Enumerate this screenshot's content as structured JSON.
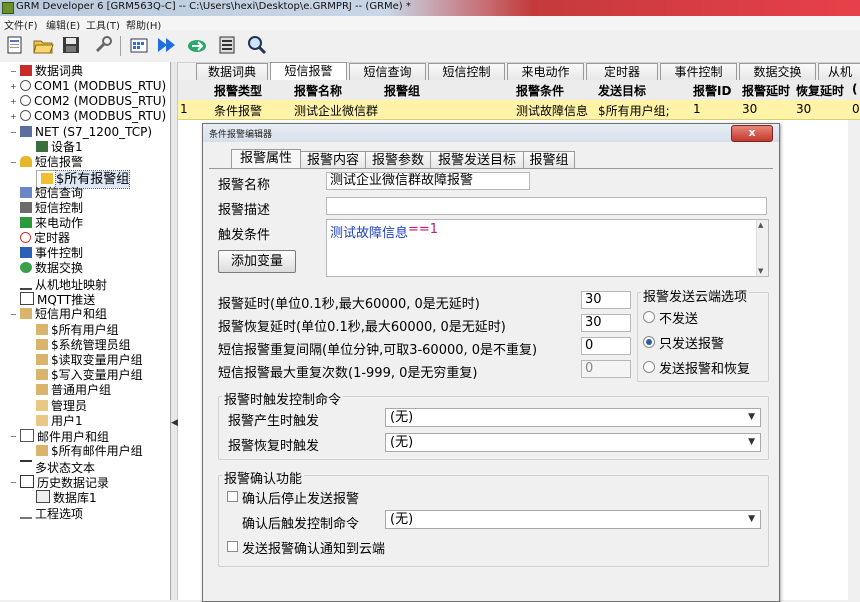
{
  "window": {
    "title": "GRM Developer 6 [GRM563Q-C]  -- C:\\Users\\hexi\\Desktop\\e.GRMPRJ -- (GRMe) *"
  },
  "menu": [
    "文件(F)",
    "编辑(E)",
    "工具(T)",
    "帮助(H)"
  ],
  "toolbar": {
    "icons": [
      "new-icon",
      "open-icon",
      "save-icon",
      "wrench-icon",
      "build-icon",
      "download-icon",
      "upload-icon",
      "device-icon",
      "search-icon"
    ]
  },
  "tree": [
    {
      "label": "数据词典",
      "icon": "book-icon",
      "exp": "−"
    },
    {
      "label": "COM1 (MODBUS_RTU)",
      "icon": "serial-icon",
      "exp": "+"
    },
    {
      "label": "COM2 (MODBUS_RTU)",
      "icon": "serial-icon",
      "exp": "+"
    },
    {
      "label": "COM3 (MODBUS_RTU)",
      "icon": "serial-icon",
      "exp": "+"
    },
    {
      "label": "NET (S7_1200_TCP)",
      "icon": "network-icon",
      "exp": "−"
    },
    {
      "label": "设备1",
      "icon": "device-icon",
      "exp": ""
    },
    {
      "label": "短信报警",
      "icon": "bell-icon",
      "exp": "−"
    },
    {
      "label": "$所有报警组",
      "icon": "alarm-group-icon",
      "exp": ""
    },
    {
      "label": "短信查询",
      "icon": "sms-query-icon",
      "exp": ""
    },
    {
      "label": "短信控制",
      "icon": "sms-control-icon",
      "exp": ""
    },
    {
      "label": "来电动作",
      "icon": "phone-icon",
      "exp": ""
    },
    {
      "label": "定时器",
      "icon": "timer-icon",
      "exp": ""
    },
    {
      "label": "事件控制",
      "icon": "event-icon",
      "exp": ""
    },
    {
      "label": "数据交换",
      "icon": "exchange-icon",
      "exp": ""
    },
    {
      "label": "从机地址映射",
      "icon": "map-icon",
      "exp": ""
    },
    {
      "label": "MQTT推送",
      "icon": "mqtt-icon",
      "exp": ""
    },
    {
      "label": "短信用户和组",
      "icon": "users-icon",
      "exp": "−"
    },
    {
      "label": "$所有用户组",
      "icon": "user-group-icon",
      "exp": ""
    },
    {
      "label": "$系统管理员组",
      "icon": "user-group-icon",
      "exp": ""
    },
    {
      "label": "$读取变量用户组",
      "icon": "user-group-icon",
      "exp": ""
    },
    {
      "label": "$写入变量用户组",
      "icon": "user-group-icon",
      "exp": ""
    },
    {
      "label": "普通用户组",
      "icon": "user-group-icon",
      "exp": ""
    },
    {
      "label": "管理员",
      "icon": "user-icon",
      "exp": ""
    },
    {
      "label": "用户1",
      "icon": "user-icon",
      "exp": ""
    },
    {
      "label": "邮件用户和组",
      "icon": "mail-icon",
      "exp": "−"
    },
    {
      "label": "$所有邮件用户组",
      "icon": "mail-group-icon",
      "exp": ""
    },
    {
      "label": "多状态文本",
      "icon": "text-icon",
      "exp": ""
    },
    {
      "label": "历史数据记录",
      "icon": "history-icon",
      "exp": "−"
    },
    {
      "label": "数据库1",
      "icon": "database-icon",
      "exp": ""
    },
    {
      "label": "工程选项",
      "icon": "wrench-icon",
      "exp": ""
    }
  ],
  "main_tabs": [
    "数据词典",
    "短信报警",
    "短信查询",
    "短信控制",
    "来电动作",
    "定时器",
    "事件控制",
    "数据交换",
    "从机"
  ],
  "grid": {
    "headers": [
      "报警类型",
      "报警名称",
      "报警组",
      "报警条件",
      "发送目标",
      "报警ID",
      "报警延时",
      "恢复延时",
      "("
    ],
    "row": [
      "1",
      "条件报警",
      "测试企业微信群",
      "",
      "测试故障信息",
      "$所有用户组;",
      "1",
      "30",
      "30",
      "0"
    ]
  },
  "dialog": {
    "title": "条件报警编辑器",
    "close": "x",
    "tabs": [
      "报警属性",
      "报警内容",
      "报警参数",
      "报警发送目标",
      "报警组"
    ],
    "name_label": "报警名称",
    "name_value": "测试企业微信群故障报警",
    "desc_label": "报警描述",
    "desc_value": "",
    "cond_label": "触发条件",
    "cond_value_text": "测试故障信息",
    "cond_value_op": "==1",
    "add_var": "添加变量",
    "params": [
      {
        "label": "报警延时(单位0.1秒,最大60000, 0是无延时)",
        "value": "30",
        "disabled": false
      },
      {
        "label": "报警恢复延时(单位0.1秒,最大60000, 0是无延时)",
        "value": "30",
        "disabled": false
      },
      {
        "label": "短信报警重复间隔(单位分钟,可取3-60000, 0是不重复)",
        "value": "0",
        "disabled": false
      },
      {
        "label": "短信报警最大重复次数(1-999, 0是无穷重复)",
        "value": "0",
        "disabled": true
      }
    ],
    "cloud": {
      "title": "报警发送云端选项",
      "options": [
        "不发送",
        "只发送报警",
        "发送报警和恢复"
      ],
      "selected": 1
    },
    "trigger": {
      "title": "报警时触发控制命令",
      "on_alarm_label": "报警产生时触发",
      "on_alarm_value": "(无)",
      "on_recover_label": "报警恢复时触发",
      "on_recover_value": "(无)"
    },
    "confirm": {
      "title": "报警确认功能",
      "stop_label": "确认后停止发送报警",
      "cmd_label": "确认后触发控制命令",
      "cmd_value": "(无)",
      "cloud_label": "发送报警确认通知到云端"
    }
  }
}
